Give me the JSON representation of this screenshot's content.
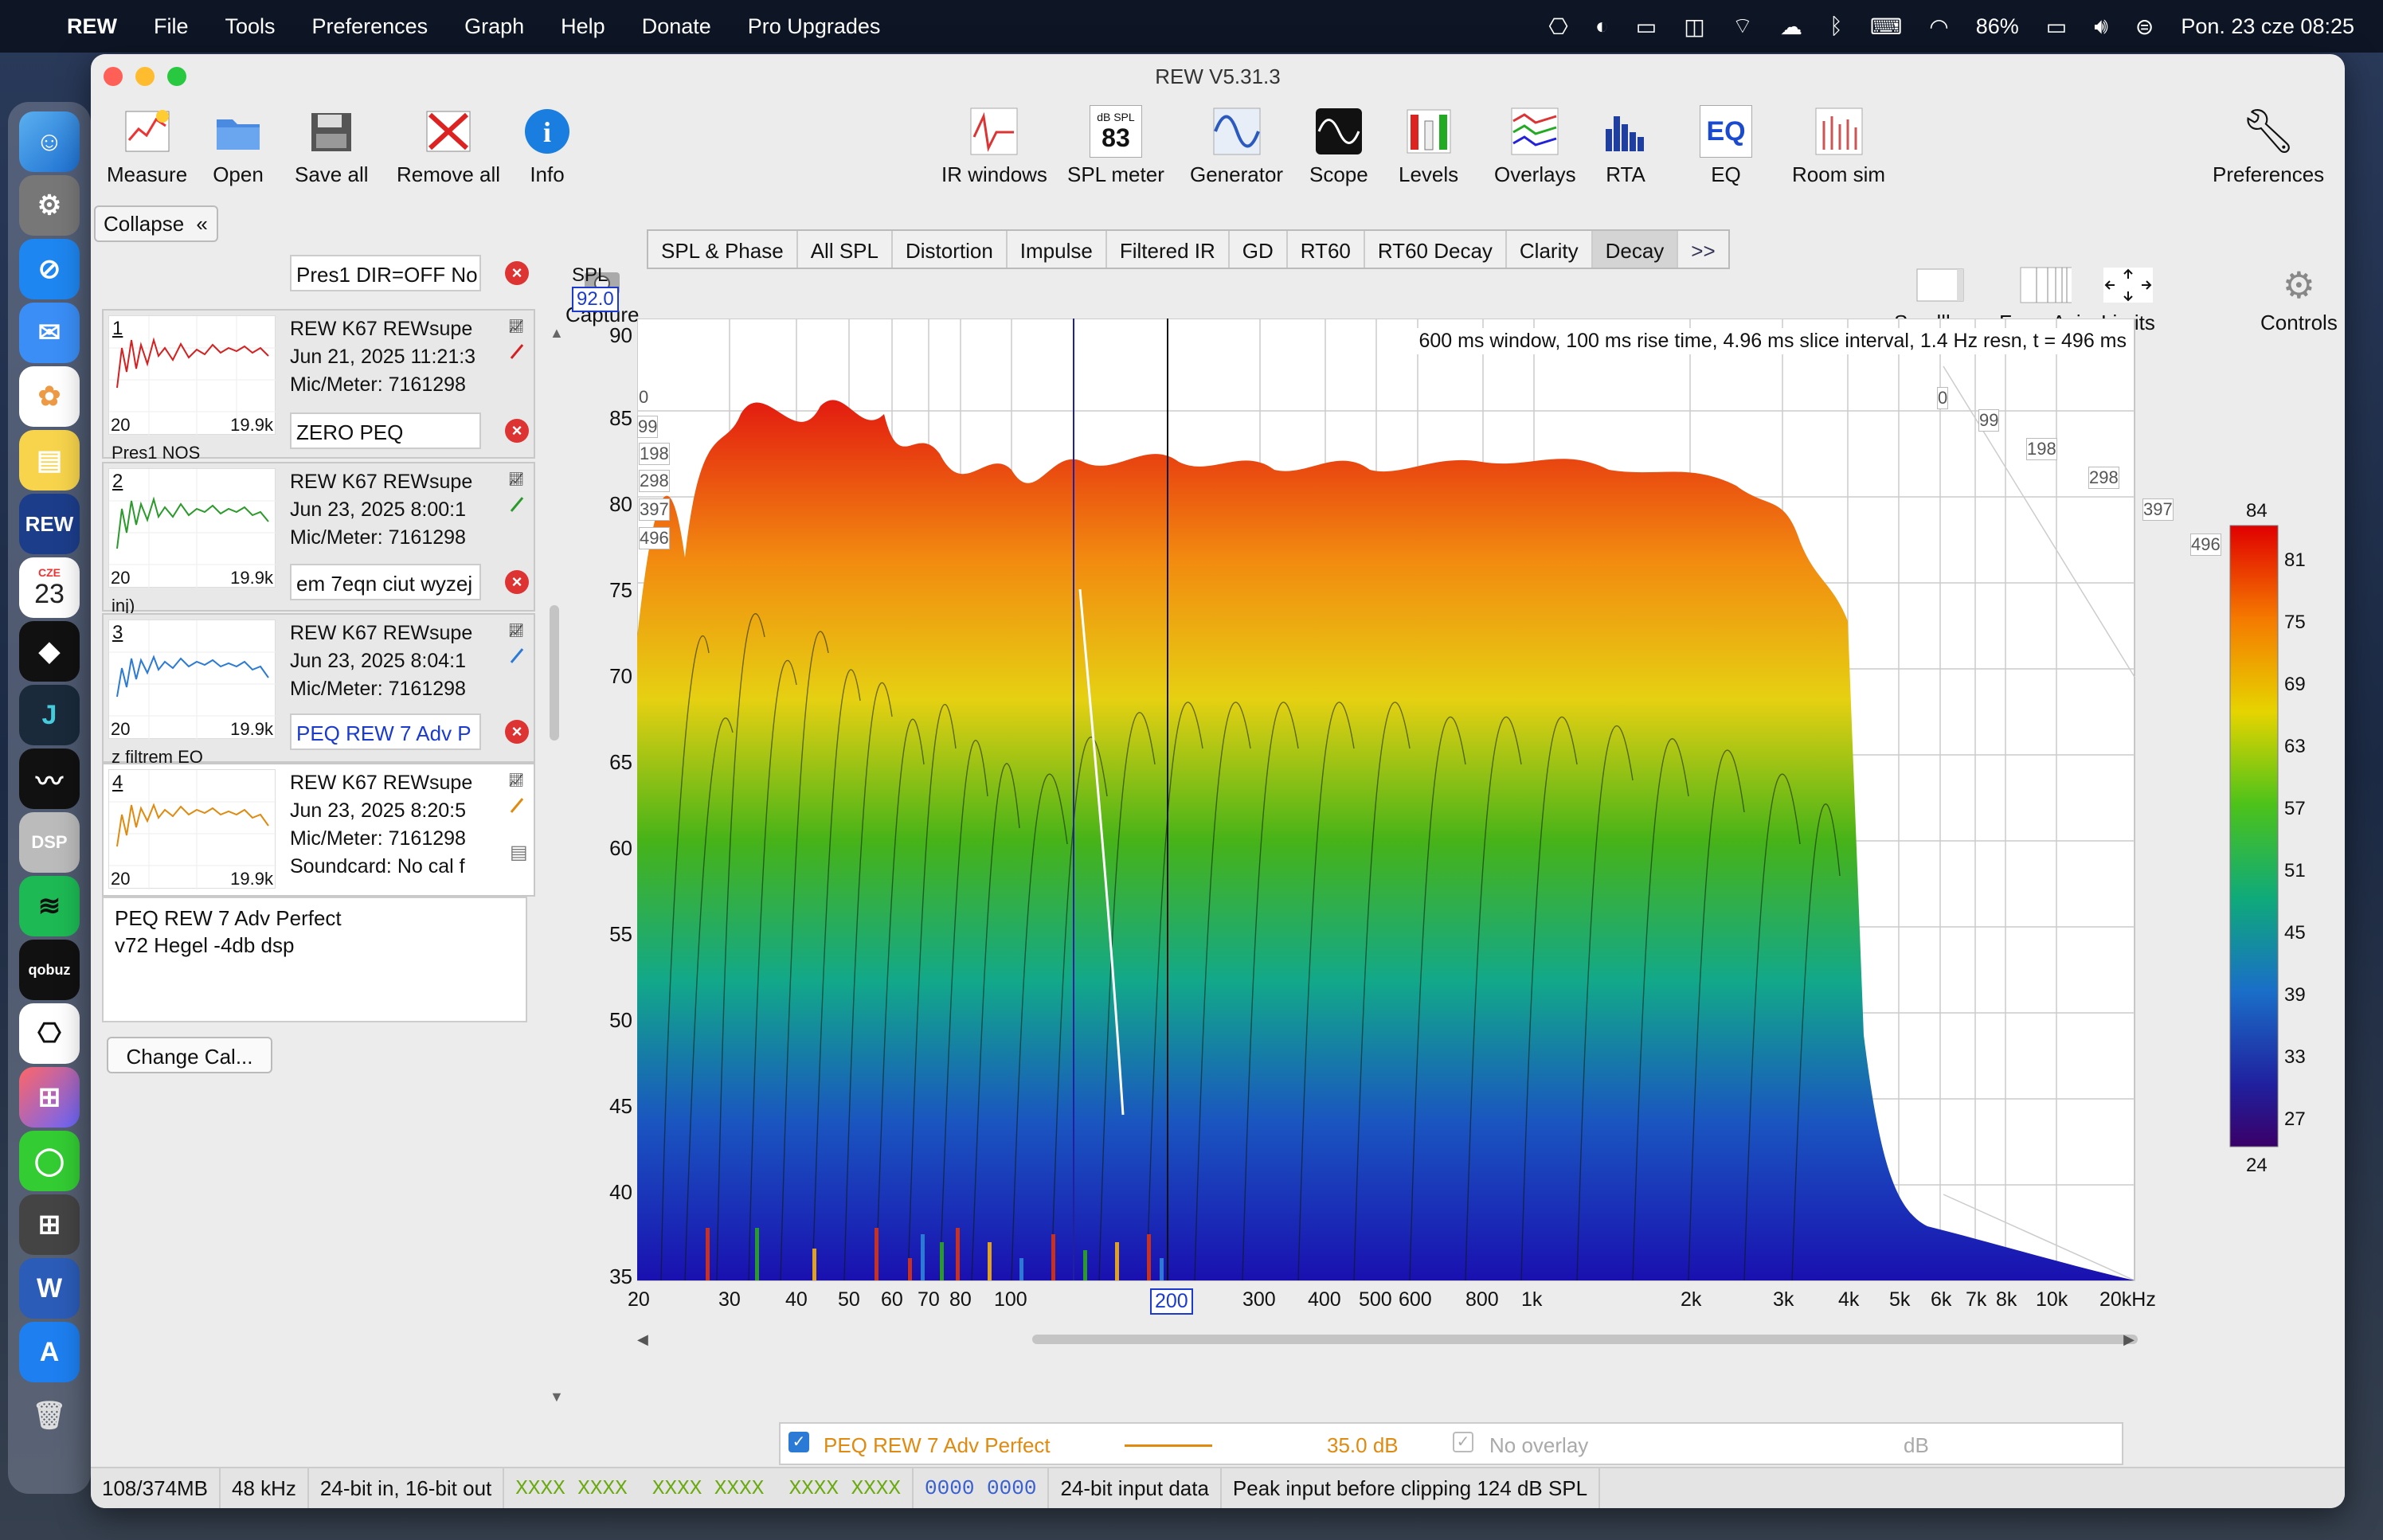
{
  "menubar": {
    "items": [
      "REW",
      "File",
      "Tools",
      "Preferences",
      "Graph",
      "Help",
      "Donate",
      "Pro Upgrades"
    ],
    "battery": "86%",
    "datetime": "Pon. 23 cze  08:25"
  },
  "dock": {
    "apps": [
      "finder",
      "settings",
      "safari",
      "mail",
      "photos",
      "notes",
      "rew",
      "calendar",
      "tidal",
      "jotform",
      "roon",
      "dsp",
      "spotify",
      "qobuz",
      "chatgpt",
      "launchpad",
      "messages",
      "calculator",
      "word",
      "app-store",
      "trash"
    ],
    "calendar_month": "CZE",
    "calendar_day": "23",
    "rew_label": "REW",
    "dsp_label": "DSP",
    "qobuz_label": "qobuz"
  },
  "window": {
    "title": "REW V5.31.3"
  },
  "toolbar": {
    "measure": "Measure",
    "open": "Open",
    "save_all": "Save all",
    "remove_all": "Remove all",
    "info": "Info",
    "ir_windows": "IR windows",
    "spl_meter": "SPL meter",
    "spl_meter_unit": "dB SPL",
    "spl_meter_value": "83",
    "generator": "Generator",
    "scope": "Scope",
    "levels": "Levels",
    "overlays": "Overlays",
    "rta": "RTA",
    "eq": "EQ",
    "room_sim": "Room sim",
    "preferences": "Preferences",
    "capture": "Capture",
    "scrollbars": "Scrollbars",
    "freq_axis": "Freq. Axis",
    "limits": "Limits",
    "controls": "Controls"
  },
  "panel": {
    "collapse": "Collapse",
    "measurements": [
      {
        "num": "1",
        "title": "Pres1 DIR=OFF No",
        "line1": "REW K67 REWsupe",
        "line2": "Jun 21, 2025 11:21:3",
        "line3": "Mic/Meter: 7161298",
        "lo": "20",
        "hi": "19.9k",
        "color": "#d62020",
        "subtitle": "Pres1 NOS"
      },
      {
        "num": "2",
        "title": "ZERO PEQ",
        "line1": "REW K67 REWsupe",
        "line2": "Jun 23, 2025 8:00:1",
        "line3": "Mic/Meter: 7161298",
        "lo": "20",
        "hi": "19.9k",
        "color": "#2a9a2a",
        "subtitle": "inj)"
      },
      {
        "num": "3",
        "title": "em 7eqn ciut wyzej",
        "line1": "REW K67 REWsupe",
        "line2": "Jun 23, 2025 8:04:1",
        "line3": "Mic/Meter: 7161298",
        "lo": "20",
        "hi": "19.9k",
        "color": "#2a7ad6",
        "subtitle": "z filtrem EQ"
      },
      {
        "num": "4",
        "title": "PEQ REW 7 Adv  P",
        "line1": "REW K67 REWsupe",
        "line2": "Jun 23, 2025 8:20:5",
        "line3": "Mic/Meter: 7161298",
        "line4": "Soundcard: No cal f",
        "lo": "20",
        "hi": "19.9k",
        "color": "#e08a10"
      }
    ],
    "notes_line1": "PEQ REW 7 Adv  Perfect",
    "notes_line2": "v72 Hegel  -4db dsp",
    "change_cal": "Change Cal..."
  },
  "tabs": [
    "SPL & Phase",
    "All SPL",
    "Distortion",
    "Impulse",
    "Filtered IR",
    "GD",
    "RT60",
    "RT60 Decay",
    "Clarity",
    "Decay"
  ],
  "tabs_more": ">>",
  "graph": {
    "info": "600 ms window, 100 ms rise time, 4.96 ms slice interval, 1.4 Hz resn, t = 496 ms",
    "y_axis_label": "SPL",
    "y_top_value": "92.0",
    "y_ticks": [
      "90",
      "85",
      "80",
      "75",
      "70",
      "65",
      "60",
      "55",
      "50",
      "45",
      "40",
      "35"
    ],
    "x_ticks": [
      "20",
      "30",
      "40",
      "50",
      "60",
      "70",
      "80",
      "100",
      "200",
      "300",
      "400",
      "500",
      "600",
      "800",
      "1k",
      "2k",
      "3k",
      "4k",
      "5k",
      "6k",
      "7k",
      "8k",
      "10k",
      "20kHz"
    ],
    "x_cursor": "200",
    "depth_labels_left": [
      "0",
      "99",
      "198",
      "298",
      "397",
      "496"
    ],
    "depth_labels_right": [
      "0",
      "99",
      "198",
      "298",
      "397",
      "496"
    ],
    "colorbar_top": "84",
    "colorbar_ticks": [
      "81",
      "75",
      "69",
      "63",
      "57",
      "51",
      "45",
      "39",
      "33",
      "27"
    ],
    "colorbar_bottom": "24"
  },
  "legend": {
    "name": "PEQ REW 7 Adv  Perfect",
    "value": "35.0 dB",
    "overlay": "No overlay",
    "unit": "dB",
    "color": "#e08a10"
  },
  "status": {
    "memory": "108/374MB",
    "rate": "48 kHz",
    "bits": "24-bit in, 16-bit out",
    "green1": "XXXX XXXX",
    "green2": "XXXX XXXX",
    "green3": "XXXX XXXX",
    "blue": "0000 0000",
    "input_data": "24-bit input data",
    "peak": "Peak input before clipping 124 dB SPL"
  }
}
